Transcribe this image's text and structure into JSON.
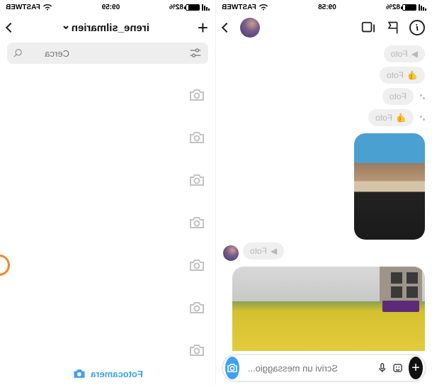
{
  "status": {
    "battery_pct": "82%",
    "time_left": "09:58",
    "time_right": "09:59",
    "carrier": "FASTWEB"
  },
  "left": {
    "photo_pill": "Foto",
    "composer_placeholder": "Scrivi un messaggio..."
  },
  "right": {
    "username": "irene_silmarien",
    "search_placeholder": "Cerca",
    "footer_label": "Fotocamera"
  },
  "icons": {
    "info": "info-icon",
    "flag": "flag-icon",
    "square": "multi-square-icon",
    "chevron": "chevron-right-icon",
    "plus": "plus-icon",
    "settings": "filter-icon",
    "search": "search-icon",
    "camera": "camera-icon",
    "gallery": "gallery-icon",
    "mic": "mic-icon"
  }
}
